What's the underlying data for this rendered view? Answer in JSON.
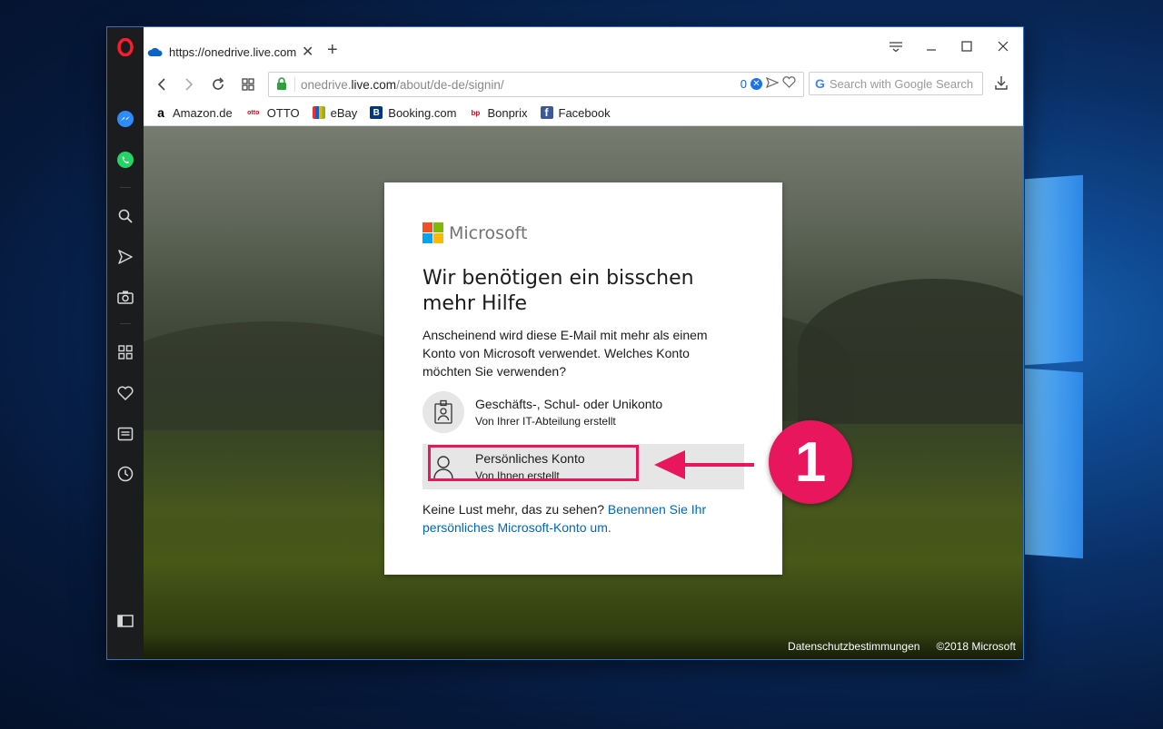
{
  "tab": {
    "title": "https://onedrive.live.com/a"
  },
  "address": {
    "prefix": "onedrive.",
    "host": "live.com",
    "path": "/about/de-de/signin/",
    "badge_count": "0"
  },
  "search": {
    "placeholder": "Search with Google Search"
  },
  "bookmarks": [
    {
      "label": "Amazon.de",
      "icon": "amazon-icon",
      "color": "#000000"
    },
    {
      "label": "OTTO",
      "icon": "otto-icon",
      "color": "#e3001b"
    },
    {
      "label": "eBay",
      "icon": "ebay-icon",
      "color": "#0064d2"
    },
    {
      "label": "Booking.com",
      "icon": "booking-icon",
      "color": "#003580"
    },
    {
      "label": "Bonprix",
      "icon": "bonprix-icon",
      "color": "#d0021b"
    },
    {
      "label": "Facebook",
      "icon": "facebook-icon",
      "color": "#3b5998"
    }
  ],
  "dialog": {
    "brand": "Microsoft",
    "title": "Wir benötigen ein bisschen mehr Hilfe",
    "description": "Anscheinend wird diese E-Mail mit mehr als einem Konto von Microsoft verwendet. Welches Konto möchten Sie verwenden?",
    "accounts": [
      {
        "name": "Geschäfts-, Schul- oder Unikonto",
        "sub": "Von Ihrer IT-Abteilung erstellt",
        "icon": "badge-id-icon"
      },
      {
        "name": "Persönliches Konto",
        "sub": "Von Ihnen erstellt",
        "icon": "person-icon"
      }
    ],
    "footer_text": "Keine Lust mehr, das zu sehen? ",
    "footer_link": "Benennen Sie Ihr persönliches Microsoft-Konto um."
  },
  "page_footer": {
    "privacy": "Datenschutzbestimmungen",
    "copyright": "©2018 Microsoft"
  },
  "annotation": {
    "number": "1",
    "color": "#e8175d"
  },
  "colors": {
    "accent_link": "#0067b8",
    "opera_red": "#ff1b2d"
  }
}
